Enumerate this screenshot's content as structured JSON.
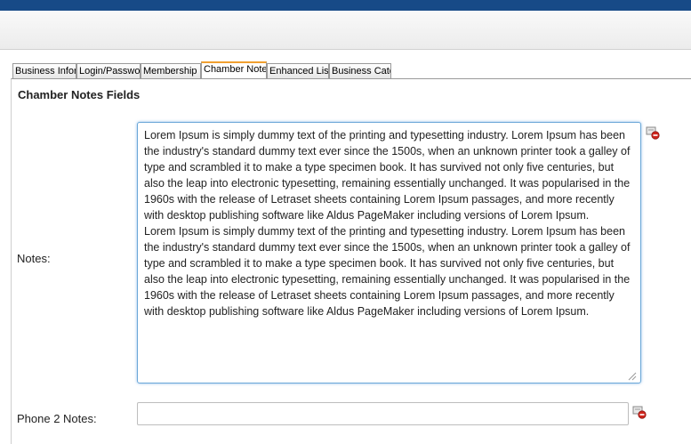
{
  "header": {
    "title": "",
    "color": "#174a87"
  },
  "tabs": [
    {
      "label": "Business Infor",
      "active": false
    },
    {
      "label": "Login/Passwor",
      "active": false
    },
    {
      "label": "Membership",
      "active": false
    },
    {
      "label": "Chamber Notes",
      "active": true
    },
    {
      "label": "Enhanced Listi",
      "active": false
    },
    {
      "label": "Business Categ",
      "active": false
    }
  ],
  "section": {
    "title": "Chamber Notes Fields"
  },
  "fields": {
    "notes": {
      "label": "Notes:",
      "value": "Lorem Ipsum is simply dummy text of the printing and typesetting industry. Lorem Ipsum has been the industry's standard dummy text ever since the 1500s, when an unknown printer took a galley of type and scrambled it to make a type specimen book. It has survived not only five centuries, but also the leap into electronic typesetting, remaining essentially unchanged. It was popularised in the 1960s with the release of Letraset sheets containing Lorem Ipsum passages, and more recently with desktop publishing software like Aldus PageMaker including versions of Lorem Ipsum.\nLorem Ipsum is simply dummy text of the printing and typesetting industry. Lorem Ipsum has been the industry's standard dummy text ever since the 1500s, when an unknown printer took a galley of type and scrambled it to make a type specimen book. It has survived not only five centuries, but also the leap into electronic typesetting, remaining essentially unchanged. It was popularised in the 1960s with the release of Letraset sheets containing Lorem Ipsum passages, and more recently with desktop publishing software like Aldus PageMaker including versions of Lorem Ipsum.",
      "delete_icon": "delete-field-icon"
    },
    "phone2_notes": {
      "label": "Phone 2 Notes:",
      "value": "",
      "placeholder": "",
      "delete_icon": "delete-field-icon"
    }
  },
  "colors": {
    "accent_tab": "#f0a030",
    "focus_border": "#6aa7d8"
  }
}
